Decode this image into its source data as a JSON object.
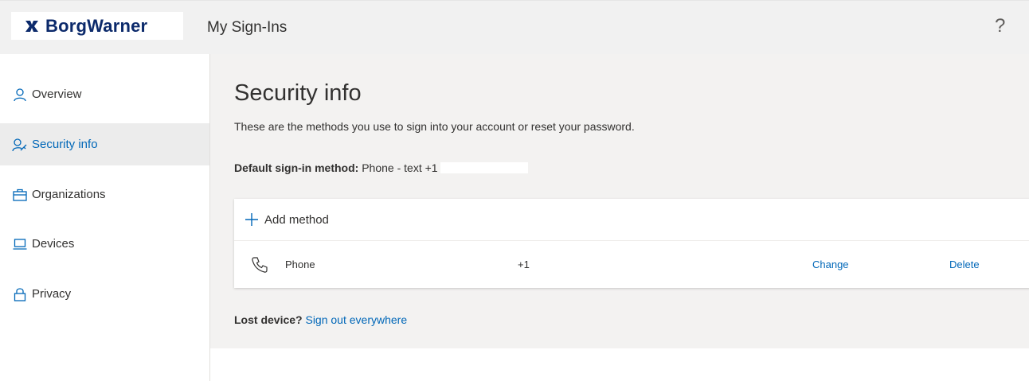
{
  "header": {
    "brand_name": "BorgWarner",
    "app_title": "My Sign-Ins",
    "help_glyph": "?"
  },
  "sidebar": {
    "items": [
      {
        "label": "Overview",
        "icon": "person-icon",
        "active": false
      },
      {
        "label": "Security info",
        "icon": "person-key-icon",
        "active": true
      },
      {
        "label": "Organizations",
        "icon": "briefcase-icon",
        "active": false
      },
      {
        "label": "Devices",
        "icon": "laptop-icon",
        "active": false
      },
      {
        "label": "Privacy",
        "icon": "lock-icon",
        "active": false
      }
    ]
  },
  "main": {
    "title": "Security info",
    "description": "These are the methods you use to sign into your account or reset your password.",
    "default_method_label": "Default sign-in method:",
    "default_method_value": "Phone - text +1",
    "add_method_label": "Add method",
    "methods": [
      {
        "name": "Phone",
        "value": "+1",
        "change_label": "Change",
        "delete_label": "Delete"
      }
    ],
    "lost_device_label": "Lost device?",
    "sign_out_everywhere_label": "Sign out everywhere"
  },
  "colors": {
    "accent": "#0067b8",
    "brand_blue": "#0c2a6b",
    "header_bg": "#f1f1f1",
    "content_bg": "#f3f2f1",
    "active_nav_bg": "#ececec"
  }
}
